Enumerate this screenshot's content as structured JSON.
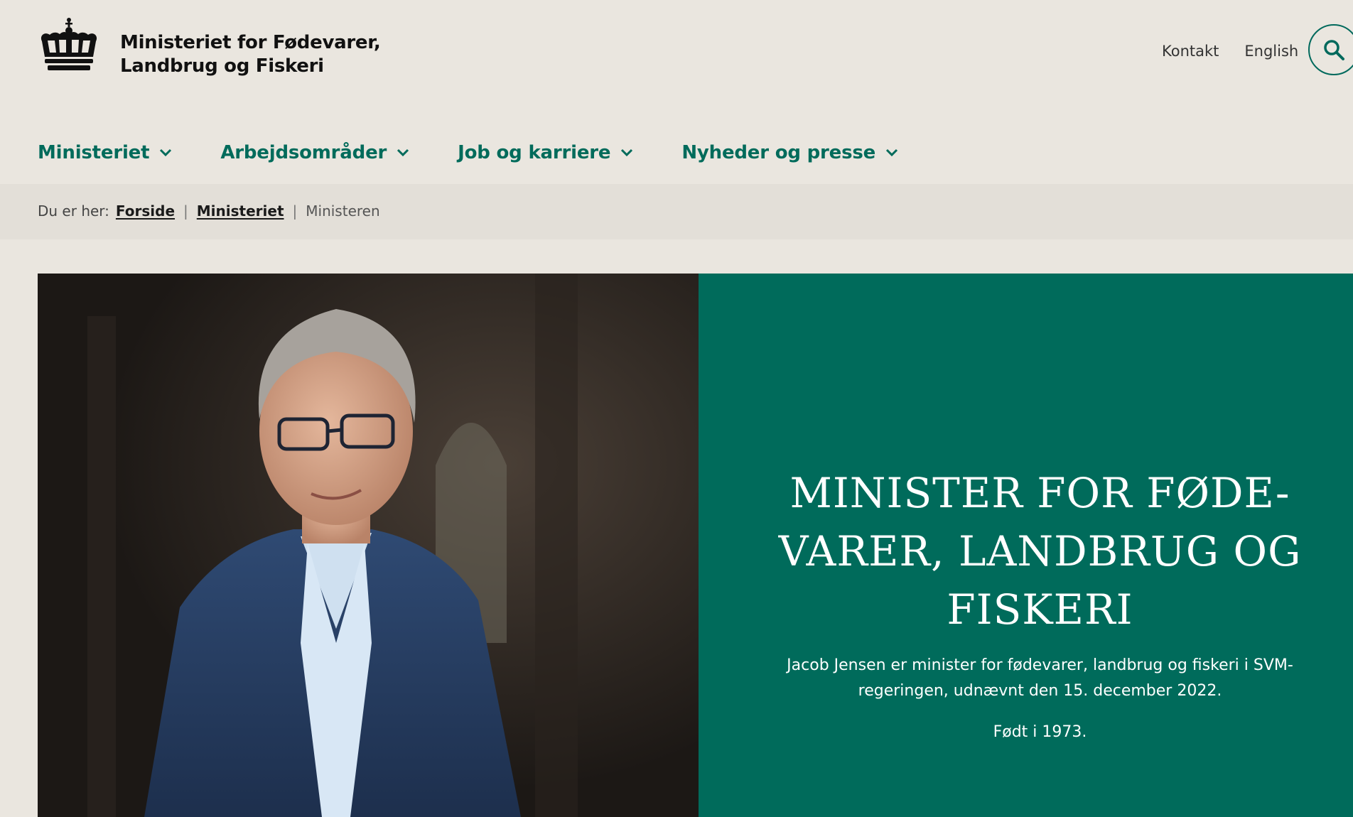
{
  "site": {
    "name_line1": "Ministeriet for Fødevarer,",
    "name_line2": "Landbrug og Fiskeri"
  },
  "utility_nav": {
    "contact": "Kontakt",
    "language": "English"
  },
  "icons": {
    "logo": "crown-icon",
    "search": "search-icon",
    "nav_chevron": "chevron-down-icon"
  },
  "main_nav": [
    {
      "label": "Ministeriet"
    },
    {
      "label": "Arbejdsområder"
    },
    {
      "label": "Job og karriere"
    },
    {
      "label": "Nyheder og presse"
    }
  ],
  "breadcrumb": {
    "prefix": "Du er her:",
    "items": [
      {
        "label": "Forside"
      },
      {
        "label": "Ministeriet"
      }
    ],
    "current": "Ministeren"
  },
  "hero": {
    "title": "MINISTER FOR FØDE-VARER, LANDBRUG OG FISKERI",
    "intro": "Jacob Jensen er minister for fødevarer, landbrug og fiskeri i SVM-regeringen, udnævnt den 15. december 2022.",
    "born": "Født i 1973."
  },
  "colors": {
    "background": "#eae6df",
    "breadcrumb_bg": "#e3dfd8",
    "accent": "#006b5b",
    "text_dark": "#111111"
  }
}
